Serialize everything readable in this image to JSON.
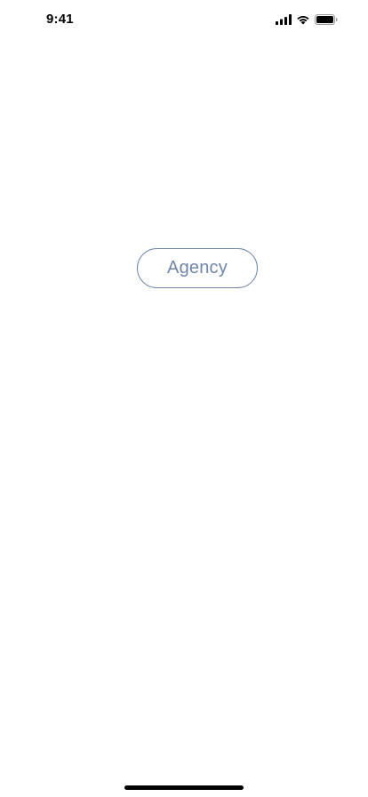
{
  "status_bar": {
    "time": "9:41",
    "icons": [
      "cellular-signal-icon",
      "wifi-icon",
      "battery-icon"
    ]
  },
  "main": {
    "agency_button_label": "Agency"
  },
  "colors": {
    "button_border": "#6d84a8",
    "button_text": "#6f86a9",
    "background": "#ffffff",
    "status_text": "#000000"
  }
}
